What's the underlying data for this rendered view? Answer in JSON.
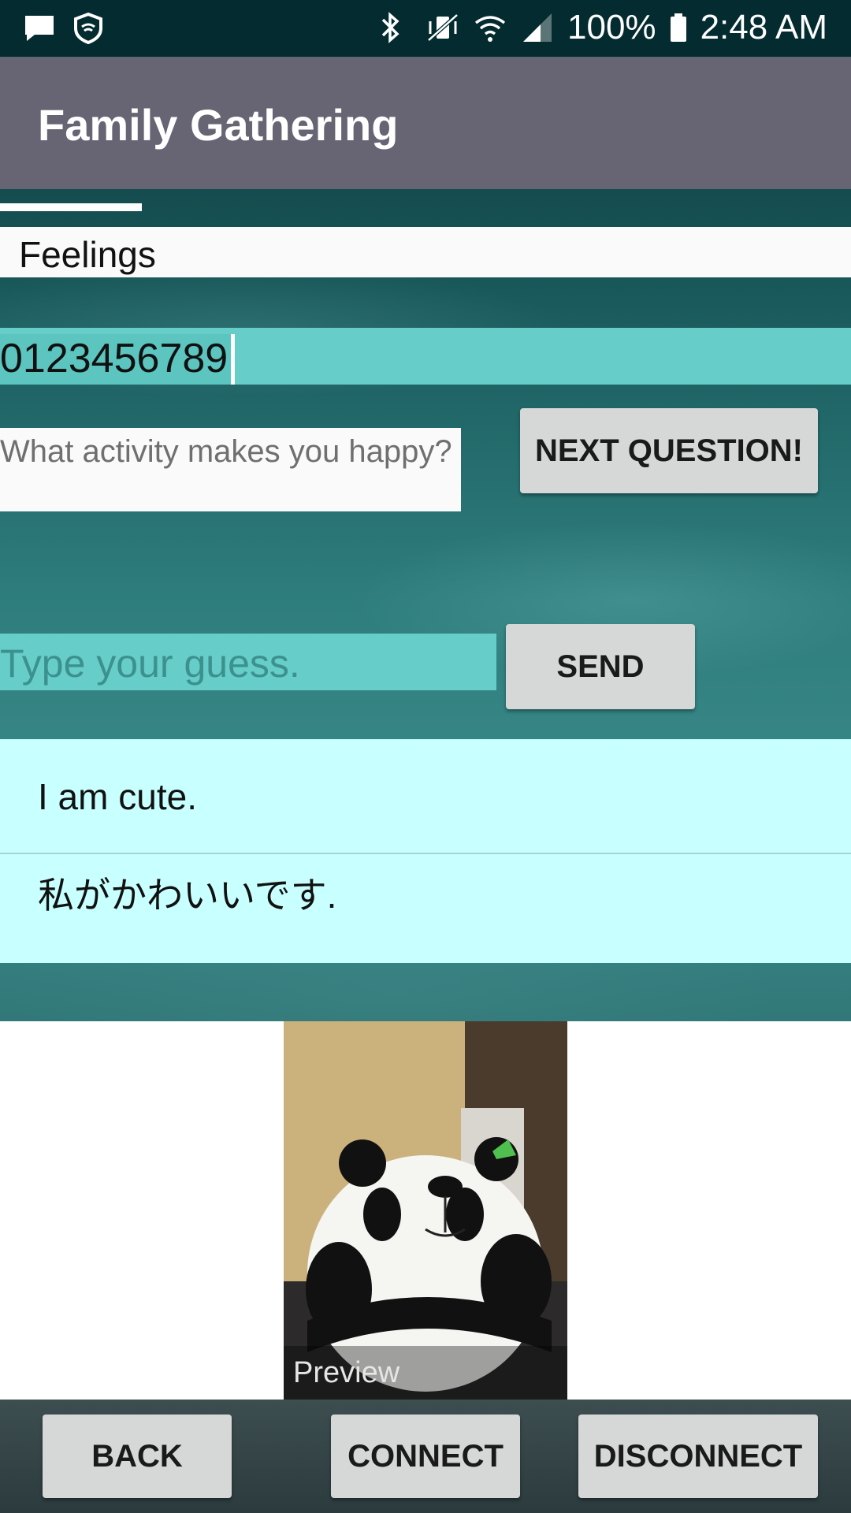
{
  "status_bar": {
    "battery": "100%",
    "time": "2:48 AM",
    "icons": [
      "message-icon",
      "shield-icon",
      "bluetooth-icon",
      "vibrate-icon",
      "wifi-icon",
      "signal-icon",
      "battery-icon"
    ]
  },
  "app_bar": {
    "title": "Family Gathering"
  },
  "category": {
    "label": "Feelings"
  },
  "code_field": {
    "value": "0123456789"
  },
  "question": {
    "text": "What activity makes you happy?"
  },
  "buttons": {
    "next_question": "NEXT QUESTION!",
    "send": "SEND",
    "back": "BACK",
    "connect": "CONNECT",
    "disconnect": "DISCONNECT"
  },
  "guess_field": {
    "placeholder": "Type your guess."
  },
  "messages": [
    {
      "text": "I am cute."
    },
    {
      "text": "私がかわいいです."
    }
  ],
  "preview": {
    "label": "Preview"
  },
  "colors": {
    "app_bar": "#676473",
    "field_teal": "#66cdc8",
    "messages_bg": "#c8ffff",
    "button": "#d6d7d7"
  }
}
